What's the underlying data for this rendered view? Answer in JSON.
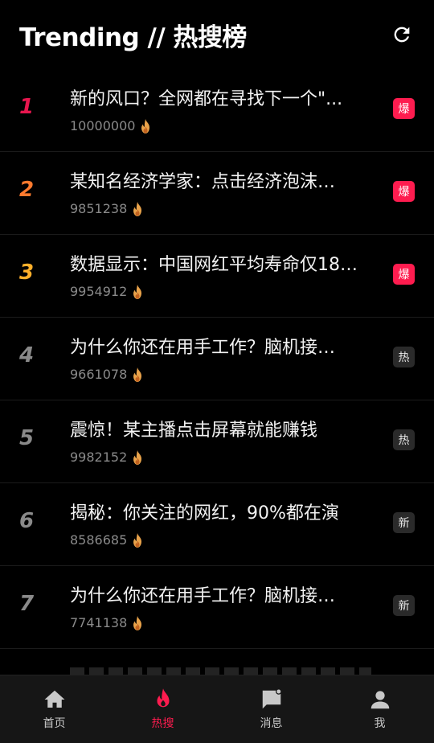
{
  "header": {
    "title": "Trending // 热搜榜",
    "refresh_icon": "refresh-icon"
  },
  "colors": {
    "accent": "#fe1c4f",
    "rank1": "#e8164e",
    "rank2": "#ff7a2e",
    "rank3": "#ffb02a",
    "rank_other": "#8a8a8a"
  },
  "items": [
    {
      "rank": "1",
      "title": "新的风口？全网都在寻找下一个\"...",
      "count": "10000000",
      "badge": "爆",
      "badge_style": "hot-bao"
    },
    {
      "rank": "2",
      "title": "某知名经济学家：点击经济泡沫…",
      "count": "9851238",
      "badge": "爆",
      "badge_style": "hot-bao"
    },
    {
      "rank": "3",
      "title": "数据显示：中国网红平均寿命仅18…",
      "count": "9954912",
      "badge": "爆",
      "badge_style": "hot-bao"
    },
    {
      "rank": "4",
      "title": "为什么你还在用手工作？脑机接…",
      "count": "9661078",
      "badge": "热",
      "badge_style": "plain"
    },
    {
      "rank": "5",
      "title": "震惊！某主播点击屏幕就能赚钱",
      "count": "9982152",
      "badge": "热",
      "badge_style": "plain"
    },
    {
      "rank": "6",
      "title": "揭秘：你关注的网红，90%都在演",
      "count": "8586685",
      "badge": "新",
      "badge_style": "plain"
    },
    {
      "rank": "7",
      "title": "为什么你还在用手工作？脑机接…",
      "count": "7741138",
      "badge": "新",
      "badge_style": "plain"
    }
  ],
  "tabbar": {
    "tabs": [
      {
        "label": "首页",
        "icon": "home-icon"
      },
      {
        "label": "热搜",
        "icon": "flame-icon",
        "active": true
      },
      {
        "label": "消息",
        "icon": "message-icon"
      },
      {
        "label": "我",
        "icon": "person-icon"
      }
    ]
  }
}
